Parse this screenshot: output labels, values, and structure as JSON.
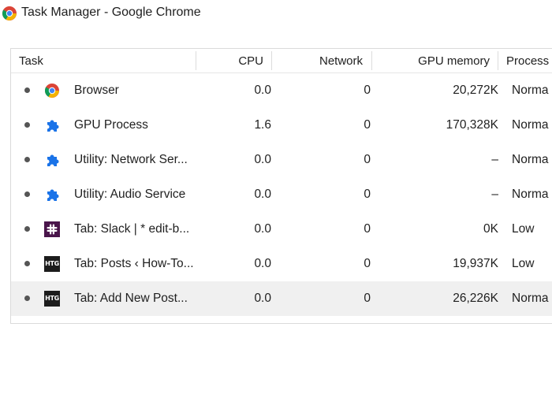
{
  "window": {
    "title": "Task Manager - Google Chrome",
    "icon": "chrome-icon"
  },
  "columns": {
    "task": "Task",
    "cpu": "CPU",
    "network": "Network",
    "gpu_memory": "GPU memory",
    "process": "Process"
  },
  "rows": [
    {
      "icon": "chrome-icon",
      "task": "Browser",
      "cpu": "0.0",
      "network": "0",
      "gpu_memory": "20,272K",
      "process": "Norma"
    },
    {
      "icon": "puzzle-icon",
      "task": "GPU Process",
      "cpu": "1.6",
      "network": "0",
      "gpu_memory": "170,328K",
      "process": "Norma"
    },
    {
      "icon": "puzzle-icon",
      "task": "Utility: Network Ser...",
      "cpu": "0.0",
      "network": "0",
      "gpu_memory": "–",
      "process": "Norma"
    },
    {
      "icon": "puzzle-icon",
      "task": "Utility: Audio Service",
      "cpu": "0.0",
      "network": "0",
      "gpu_memory": "–",
      "process": "Norma"
    },
    {
      "icon": "slack-icon",
      "task": "Tab: Slack | * edit-b...",
      "cpu": "0.0",
      "network": "0",
      "gpu_memory": "0K",
      "process": "Low"
    },
    {
      "icon": "htg-icon",
      "icon_text": "HTG",
      "task": "Tab: Posts ‹ How-To...",
      "cpu": "0.0",
      "network": "0",
      "gpu_memory": "19,937K",
      "process": "Low"
    },
    {
      "icon": "htg-icon",
      "icon_text": "HTG",
      "task": "Tab: Add New Post...",
      "cpu": "0.0",
      "network": "0",
      "gpu_memory": "26,226K",
      "process": "Norma",
      "selected": true
    }
  ],
  "colors": {
    "selected_row": "#f0f0f0",
    "puzzle_blue": "#1a73e8",
    "slack_purple": "#4a154b",
    "htg_black": "#1c1c1c"
  }
}
